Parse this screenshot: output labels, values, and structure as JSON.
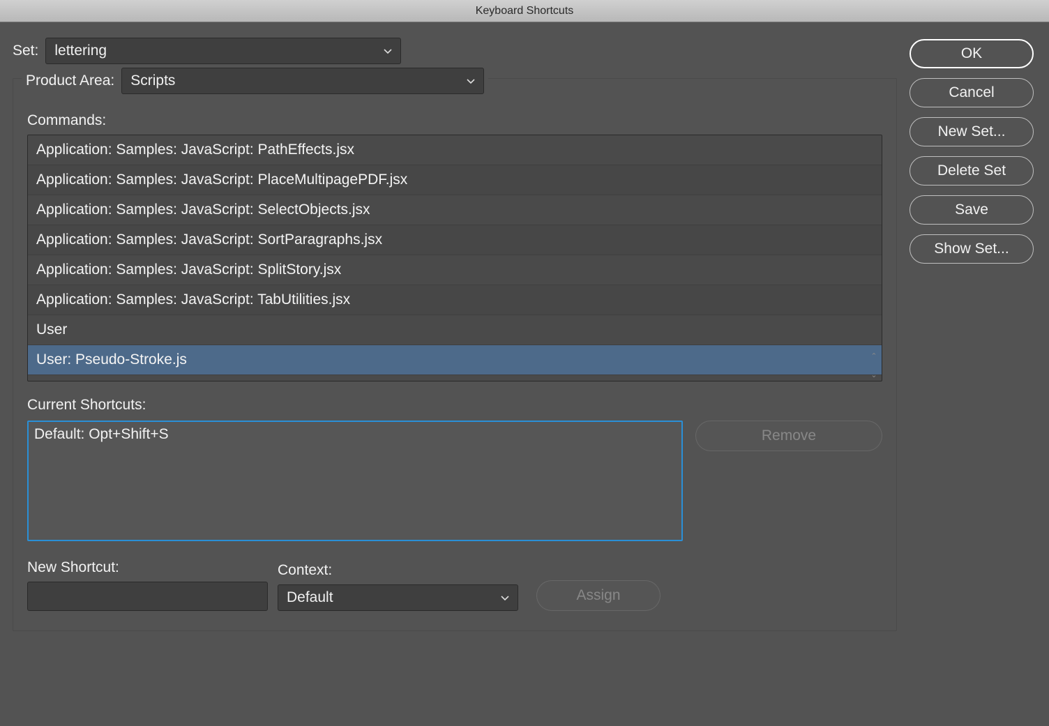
{
  "title": "Keyboard Shortcuts",
  "labels": {
    "set": "Set:",
    "productArea": "Product Area:",
    "commands": "Commands:",
    "currentShortcuts": "Current Shortcuts:",
    "newShortcut": "New Shortcut:",
    "context": "Context:"
  },
  "set": {
    "value": "lettering"
  },
  "productArea": {
    "value": "Scripts"
  },
  "context": {
    "value": "Default"
  },
  "commands": [
    {
      "label": "Application: Samples: JavaScript: PathEffects.jsx",
      "selected": false
    },
    {
      "label": "Application: Samples: JavaScript: PlaceMultipagePDF.jsx",
      "selected": false
    },
    {
      "label": "Application: Samples: JavaScript: SelectObjects.jsx",
      "selected": false
    },
    {
      "label": "Application: Samples: JavaScript: SortParagraphs.jsx",
      "selected": false
    },
    {
      "label": "Application: Samples: JavaScript: SplitStory.jsx",
      "selected": false
    },
    {
      "label": "Application: Samples: JavaScript: TabUtilities.jsx",
      "selected": false
    },
    {
      "label": "User",
      "selected": false
    },
    {
      "label": "User: Pseudo-Stroke.js",
      "selected": true
    }
  ],
  "currentShortcuts": [
    "Default: Opt+Shift+S"
  ],
  "buttons": {
    "ok": "OK",
    "cancel": "Cancel",
    "newSet": "New Set...",
    "deleteSet": "Delete Set",
    "save": "Save",
    "showSet": "Show Set...",
    "remove": "Remove",
    "assign": "Assign"
  }
}
